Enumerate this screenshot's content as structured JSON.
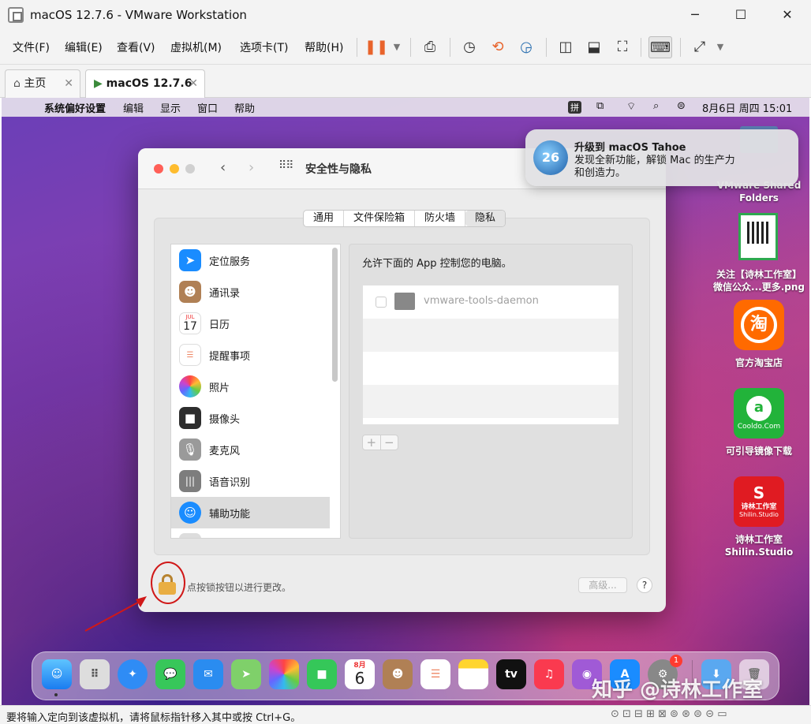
{
  "window": {
    "title": "macOS 12.7.6 - VMware Workstation",
    "min": "─",
    "max": "☐",
    "close": "✕"
  },
  "vmware_menu": [
    "文件(F)",
    "编辑(E)",
    "查看(V)",
    "虚拟机(M)",
    "选项卡(T)",
    "帮助(H)"
  ],
  "tabs": {
    "home": "主页",
    "vm": "macOS 12.7.6",
    "close": "✕"
  },
  "mac_menu": {
    "apple": "",
    "items": [
      "系统偏好设置",
      "编辑",
      "显示",
      "窗口",
      "帮助"
    ],
    "ime": "拼",
    "clock": "8月6日 周四  15:01"
  },
  "pref": {
    "title": "安全性与隐私",
    "segments": [
      "通用",
      "文件保险箱",
      "防火墙",
      "隐私"
    ],
    "selected_segment": "隐私",
    "privacy_items": [
      {
        "label": "定位服务",
        "icon": "location-icon",
        "color": "#1a8cff"
      },
      {
        "label": "通讯录",
        "icon": "contacts-icon",
        "color": "#b08055"
      },
      {
        "label": "日历",
        "icon": "calendar-icon",
        "color": "#ffffff"
      },
      {
        "label": "提醒事项",
        "icon": "reminders-icon",
        "color": "#ffffff"
      },
      {
        "label": "照片",
        "icon": "photos-icon",
        "color": "#ffffff"
      },
      {
        "label": "摄像头",
        "icon": "camera-icon",
        "color": "#2d2d2d"
      },
      {
        "label": "麦克风",
        "icon": "microphone-icon",
        "color": "#9a9a9a"
      },
      {
        "label": "语音识别",
        "icon": "speech-recognition-icon",
        "color": "#7d7d7d"
      },
      {
        "label": "辅助功能",
        "icon": "accessibility-icon",
        "color": "#1a8cff"
      }
    ],
    "selected_item": "辅助功能",
    "calendar_month": "JUL",
    "calendar_day": "17",
    "right_heading": "允许下面的 App 控制您的电脑。",
    "apps": [
      {
        "name": "vmware-tools-daemon",
        "checked": false
      }
    ],
    "plus": "+",
    "minus": "−",
    "lock_text": "点按锁按钮以进行更改。",
    "advanced": "高级...",
    "help": "?"
  },
  "notification": {
    "title": "升级到 macOS Tahoe",
    "body1": "发现全新功能，解锁 Mac 的生产力",
    "body2": "和创造力。",
    "badge": "26"
  },
  "desktop": [
    {
      "label": "VMware Shared Folders"
    },
    {
      "label1": "关注【诗林工作室】",
      "label2": "微信公众...更多.png"
    },
    {
      "label": "官方淘宝店",
      "glyph": "淘"
    },
    {
      "label": "可引导镜像下载",
      "glyph": "a",
      "sub": "Cooldo.Com"
    },
    {
      "label1": "诗林工作室",
      "label2": "Shilin.Studio",
      "glyph": "S",
      "sub1": "诗林工作室",
      "sub2": "Shilin.Studio"
    }
  ],
  "dock": {
    "calendar_month": "8月",
    "calendar_day": "6",
    "tv": "tv",
    "badge": "1"
  },
  "watermark": "知乎 @诗林工作室",
  "status": "要将输入定向到该虚拟机，请将鼠标指针移入其中或按 Ctrl+G。"
}
